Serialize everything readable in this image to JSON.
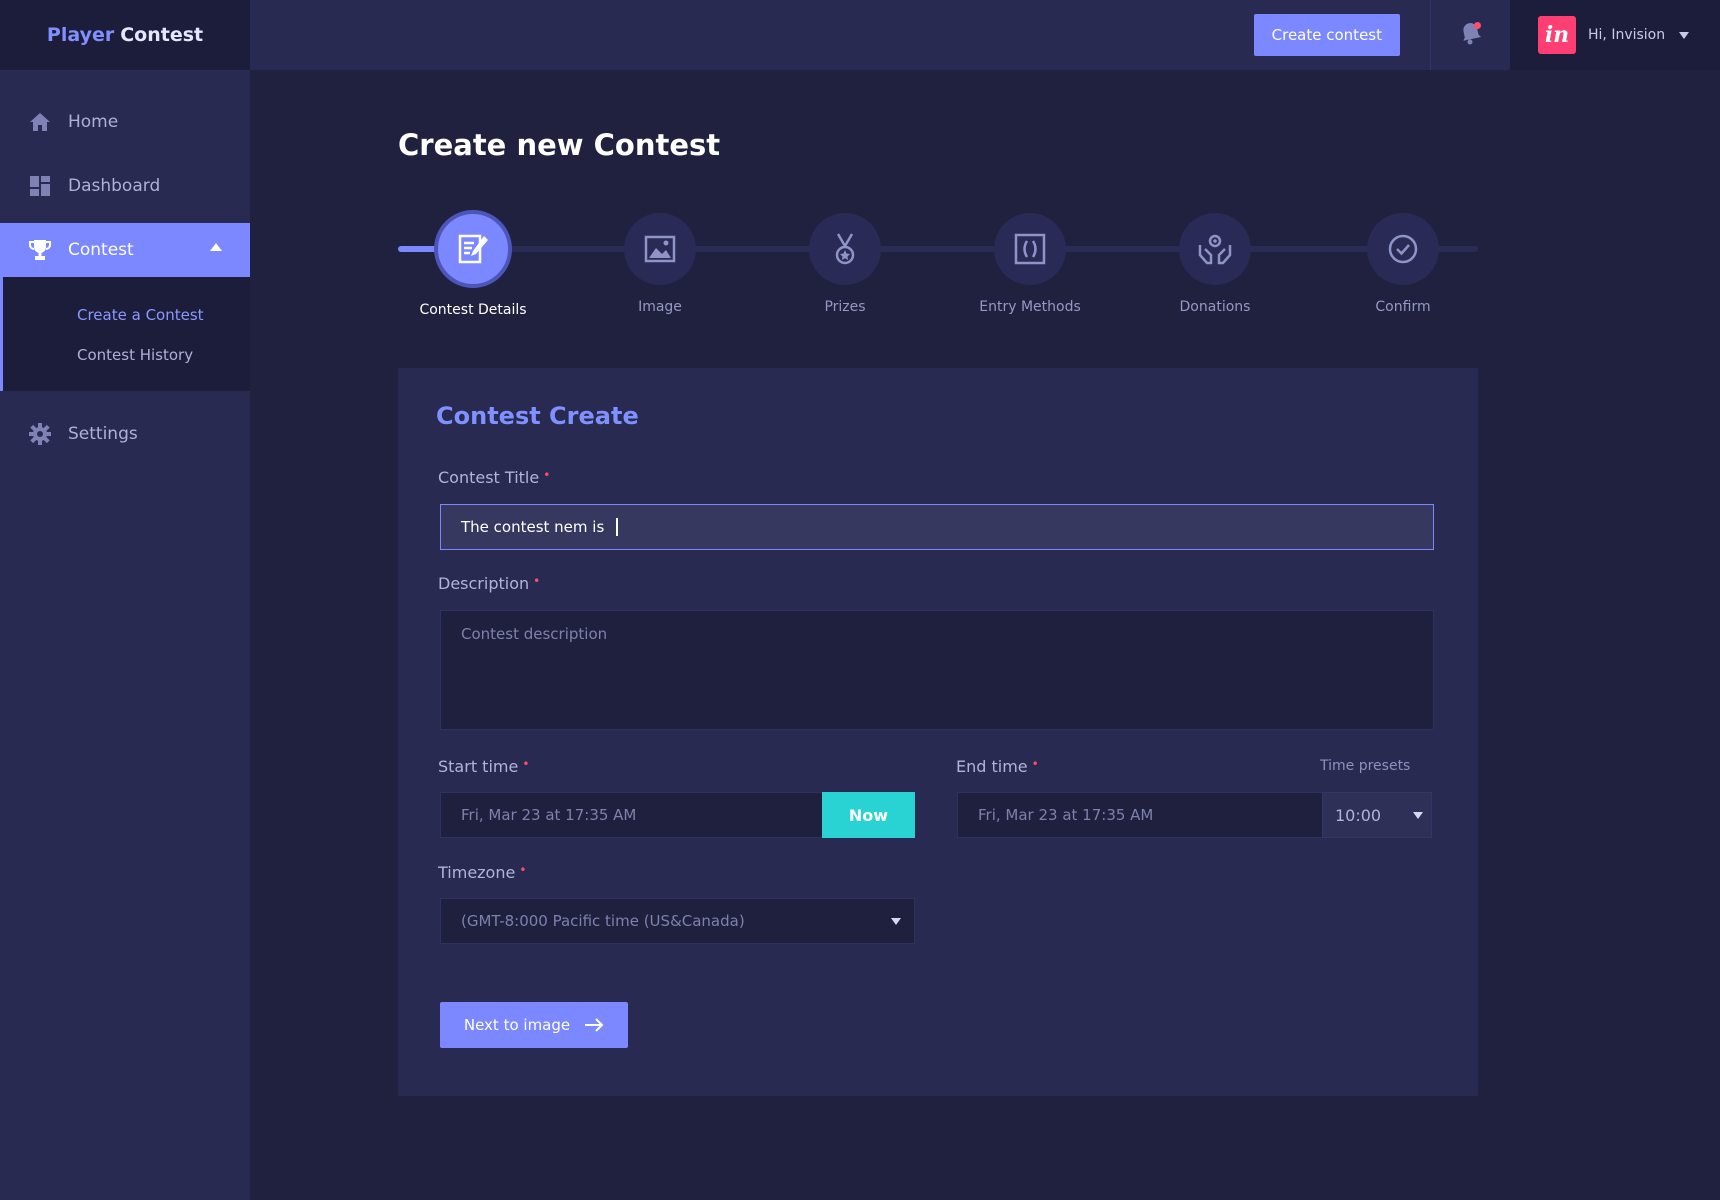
{
  "brand": {
    "part1": "Player",
    "part2": "Contest"
  },
  "sidebar": {
    "items": [
      {
        "label": "Home",
        "icon": "home-icon"
      },
      {
        "label": "Dashboard",
        "icon": "dashboard-icon"
      },
      {
        "label": "Contest",
        "icon": "trophy-icon"
      },
      {
        "label": "Settings",
        "icon": "gear-icon"
      }
    ],
    "contest_sub": [
      {
        "label": "Create a Contest"
      },
      {
        "label": "Contest History"
      }
    ]
  },
  "topbar": {
    "create_label": "Create contest",
    "user_greeting": "Hi, Invision",
    "avatar_text": "in"
  },
  "page": {
    "title": "Create new Contest"
  },
  "steps": [
    {
      "label": "Contest Details",
      "icon": "edit-document-icon"
    },
    {
      "label": "Image",
      "icon": "image-icon"
    },
    {
      "label": "Prizes",
      "icon": "medal-icon"
    },
    {
      "label": "Entry Methods",
      "icon": "entry-icon"
    },
    {
      "label": "Donations",
      "icon": "donation-hands-icon"
    },
    {
      "label": "Confirm",
      "icon": "check-circle-icon"
    }
  ],
  "form": {
    "card_title": "Contest Create",
    "title_label": "Contest Title",
    "title_value": "The contest nem is",
    "description_label": "Description",
    "description_placeholder": "Contest description",
    "start_label": "Start time",
    "start_value": "Fri, Mar 23 at 17:35 AM",
    "now_label": "Now",
    "end_label": "End time",
    "end_value": "Fri, Mar 23 at 17:35 AM",
    "presets_label": "Time presets",
    "preset_value": "10:00",
    "timezone_label": "Timezone",
    "timezone_value": "(GMT-8:000 Pacific time (US&Canada)",
    "next_label": "Next to image"
  },
  "colors": {
    "accent": "#7b88ff",
    "now_button": "#29d3d3",
    "required": "#ff4d6a",
    "avatar": "#ff3e73"
  }
}
